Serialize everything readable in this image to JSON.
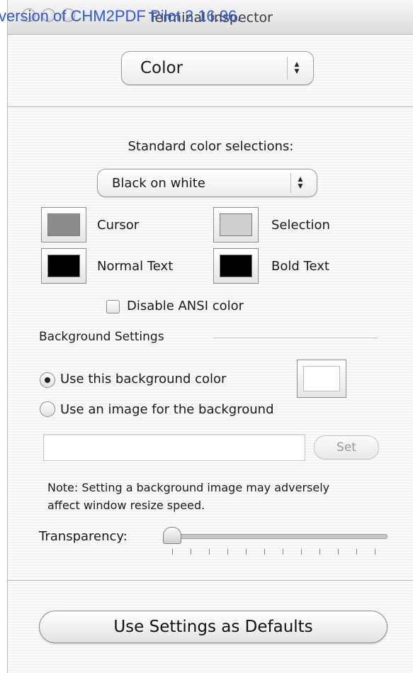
{
  "watermark": "version of CHM2PDF Pilot 2.16.96.",
  "window": {
    "title": "Terminal Inspector"
  },
  "panel_popup": {
    "selected": "Color"
  },
  "standard": {
    "label": "Standard color selections:",
    "selected": "Black on white"
  },
  "colors": {
    "cursor": {
      "label": "Cursor",
      "color": "#8c8c8c"
    },
    "selection": {
      "label": "Selection",
      "color": "#cfcfcf"
    },
    "normal_text": {
      "label": "Normal Text",
      "color": "#000000"
    },
    "bold_text": {
      "label": "Bold Text",
      "color": "#000000"
    }
  },
  "disable_ansi": {
    "label": "Disable ANSI color",
    "checked": false
  },
  "background": {
    "section_label": "Background Settings",
    "option_color": {
      "label": "Use this background color",
      "selected": true
    },
    "bg_color": "#ffffff",
    "option_image": {
      "label": "Use an image for the background",
      "selected": false
    },
    "image_path": "",
    "set_label": "Set",
    "note": "Note: Setting a background image may adversely affect window resize speed."
  },
  "transparency": {
    "label": "Transparency:",
    "value": 0
  },
  "defaults_button": {
    "label": "Use Settings as Defaults"
  }
}
